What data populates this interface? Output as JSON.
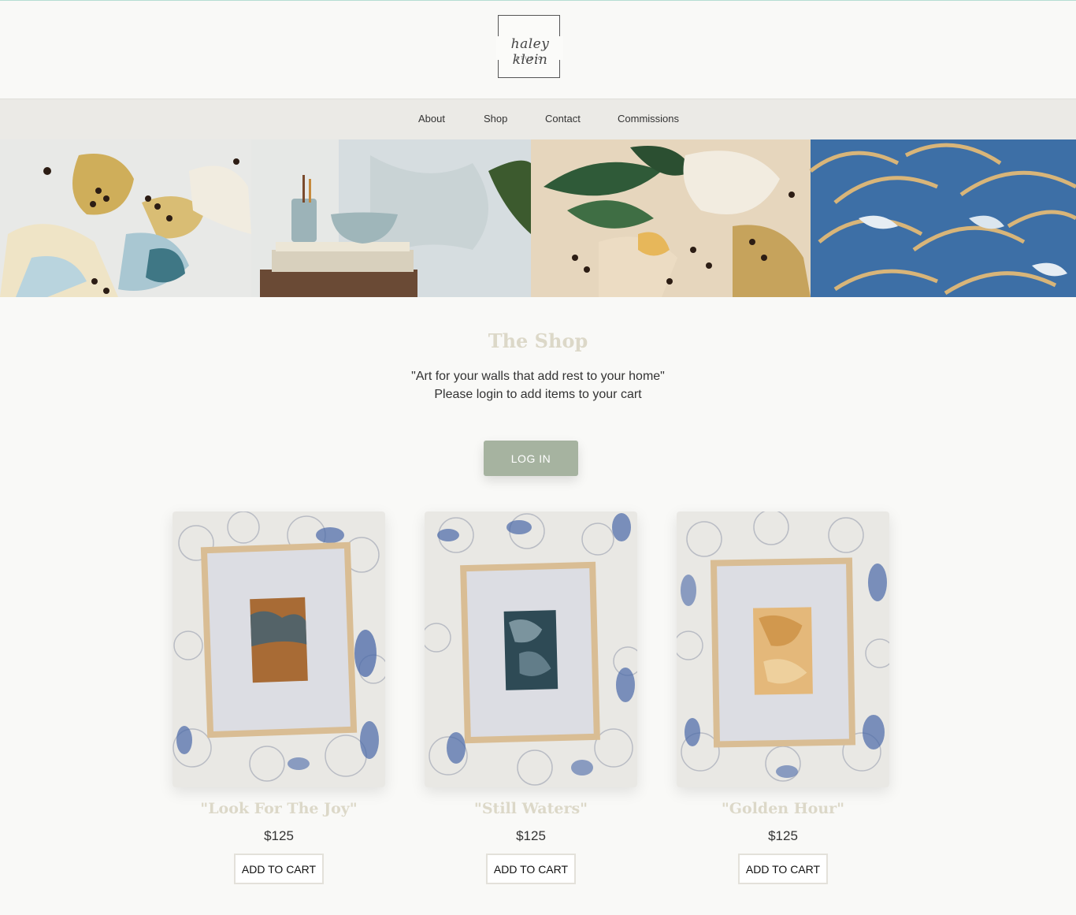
{
  "brand": {
    "logo_script": "haley klein",
    "logo_sub": "STUDIO"
  },
  "nav": {
    "items": [
      {
        "label": "About"
      },
      {
        "label": "Shop"
      },
      {
        "label": "Contact"
      },
      {
        "label": "Commissions"
      }
    ]
  },
  "shop": {
    "title": "The Shop",
    "tagline": "\"Art for your walls that add rest to your home\"",
    "login_note": "Please login to add items to your cart",
    "login_button": "LOG IN"
  },
  "products": [
    {
      "title": "\"Look For The Joy\"",
      "price": "$125",
      "button": "ADD TO CART"
    },
    {
      "title": "\"Still Waters\"",
      "price": "$125",
      "button": "ADD TO CART"
    },
    {
      "title": "\"Golden Hour\"",
      "price": "$125",
      "button": "ADD TO CART"
    }
  ],
  "colors": {
    "accent_button": "#a6b3a0",
    "heading": "#dcd8c8",
    "nav_bg": "#ebeae6",
    "page_bg": "#f9f9f7"
  }
}
